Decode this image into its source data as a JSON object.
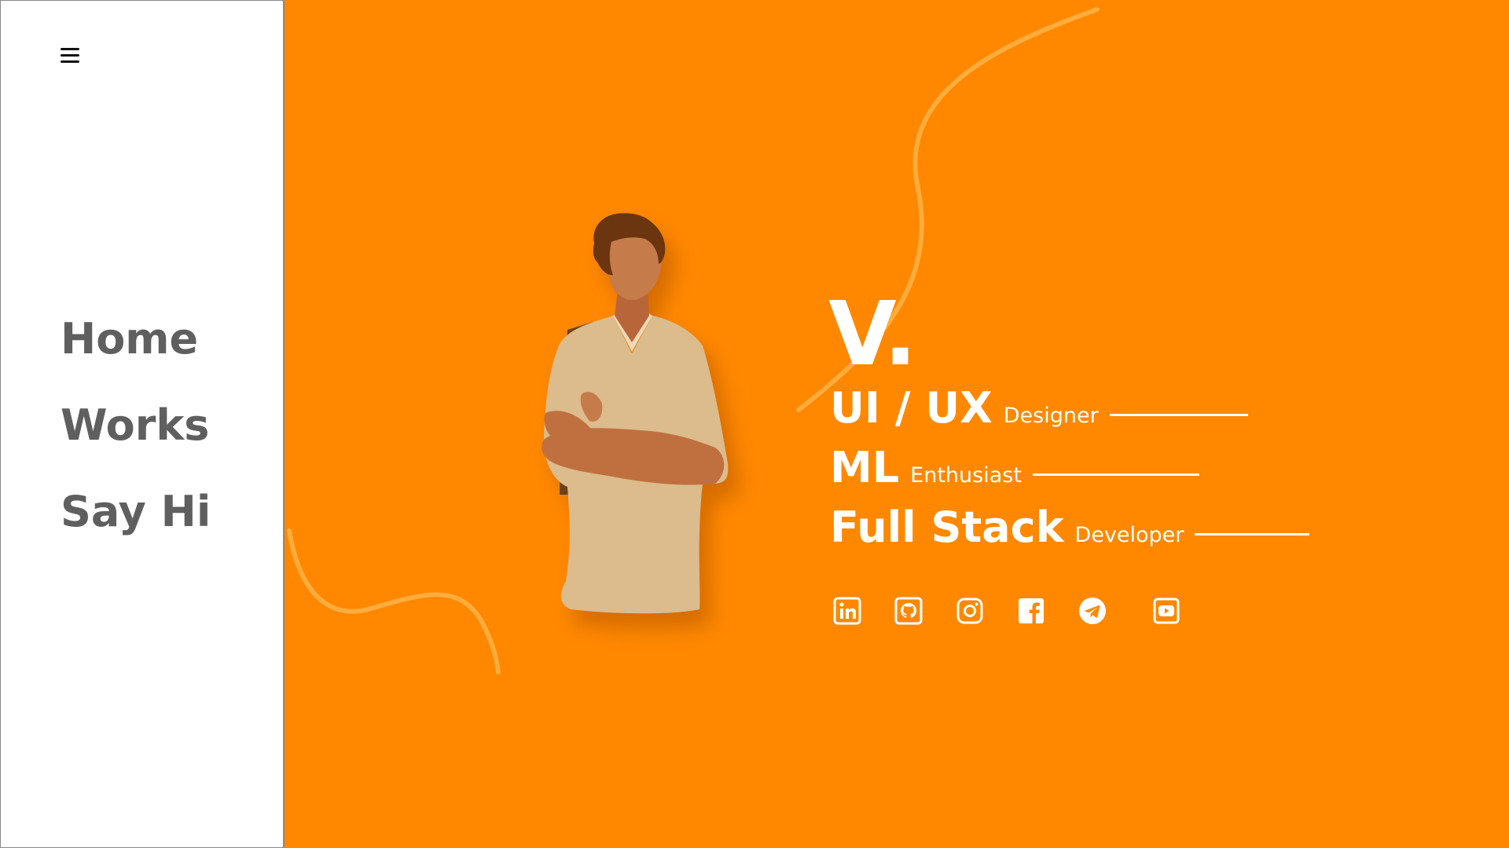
{
  "sidebar": {
    "nav": [
      {
        "label": "Home"
      },
      {
        "label": "Works"
      },
      {
        "label": "Say Hi"
      }
    ]
  },
  "hero": {
    "logo": "V.",
    "roles": [
      {
        "title": "UI / UX",
        "subtitle": "Designer"
      },
      {
        "title": "ML",
        "subtitle": "Enthusiast"
      },
      {
        "title": "Full Stack",
        "subtitle": "Developer"
      }
    ],
    "socials": [
      "linkedin-icon",
      "github-icon",
      "instagram-icon",
      "facebook-icon",
      "telegram-icon",
      "youtube-icon"
    ]
  },
  "colors": {
    "accent": "#ff8800",
    "sidebar_bg": "#ffffff",
    "nav_text": "#5f5f5f",
    "hero_text": "#ffffff",
    "deco_stroke": "#ffb347"
  }
}
